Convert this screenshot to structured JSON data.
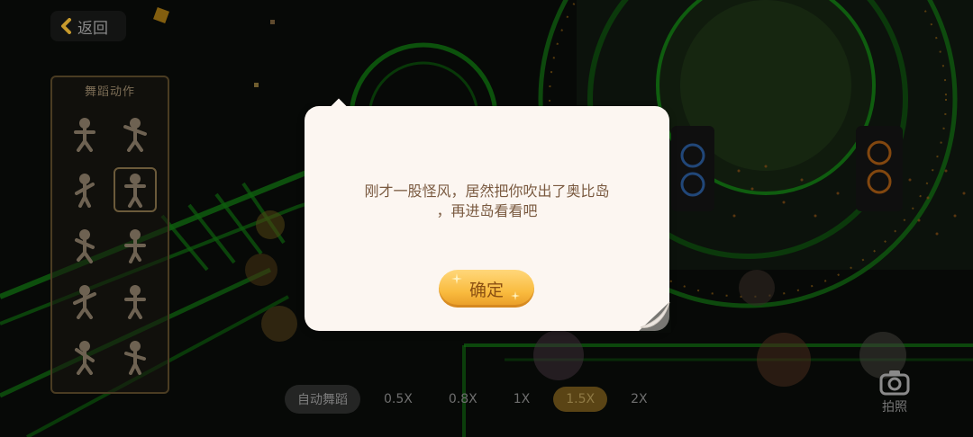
{
  "header": {
    "back_label": "返回"
  },
  "dance_panel": {
    "title": "舞蹈动作"
  },
  "speed_bar": {
    "auto_label": "自动舞蹈",
    "options": [
      "0.5X",
      "0.8X",
      "1X",
      "1.5X",
      "2X"
    ],
    "selected": "1.5X"
  },
  "photo": {
    "label": "拍照"
  },
  "dialog": {
    "message_line1": "刚才一股怪风，居然把你吹出了奥比岛",
    "message_line2": "，再进岛看看吧",
    "confirm_label": "确定"
  },
  "colors": {
    "neon_green": "#1fb31f",
    "dialog_bg": "#fcf6f1",
    "button_gold": "#f9bb3e",
    "message_text": "#7a5a40"
  }
}
